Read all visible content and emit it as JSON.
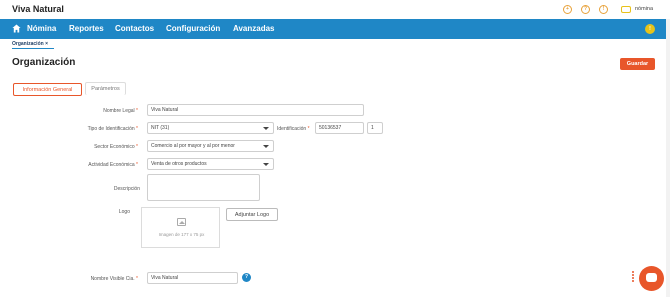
{
  "app": {
    "title": "Viva Natural"
  },
  "top_icons": [
    {
      "icon": "plus-circle-icon",
      "glyph": "+"
    },
    {
      "icon": "question-circle-icon",
      "glyph": "?"
    },
    {
      "icon": "alert-circle-icon",
      "glyph": "!"
    }
  ],
  "user": {
    "label": "nómina"
  },
  "nav": {
    "items": [
      "Nómina",
      "Reportes",
      "Contactos",
      "Configuración",
      "Avanzadas"
    ],
    "badge": "!"
  },
  "breadcrumb": {
    "label": "Organización",
    "close": "×"
  },
  "page": {
    "title": "Organización",
    "save_label": "Guardar"
  },
  "tabs": [
    {
      "label": "Información General",
      "active": true
    },
    {
      "label": "Parámetros",
      "active": false
    }
  ],
  "form": {
    "nombre_legal": {
      "label": "Nombre Legal",
      "value": "Viva Natural"
    },
    "tipo_identificacion": {
      "label": "Tipo de Identificación",
      "value": "NIT (31)"
    },
    "identificacion": {
      "label": "Identificación",
      "value": "50136537",
      "dv": "1"
    },
    "sector_economico": {
      "label": "Sector Económico",
      "value": "Comercio al por mayor y al por menor"
    },
    "actividad_economica": {
      "label": "Actividad Económica",
      "value": "Venta de otros productos"
    },
    "descripcion": {
      "label": "Descripción",
      "value": ""
    },
    "logo": {
      "label": "Logo",
      "hint": "Imagen de 177 x 75 px",
      "button": "Adjuntar Logo"
    },
    "nombre_visible": {
      "label": "Nombre Visible Cia.",
      "value": "Viva Natural",
      "help": "?"
    },
    "required_mark": "*"
  },
  "colors": {
    "nav": "#1f87c6",
    "accent": "#e8562a",
    "badge": "#e6c31a"
  }
}
